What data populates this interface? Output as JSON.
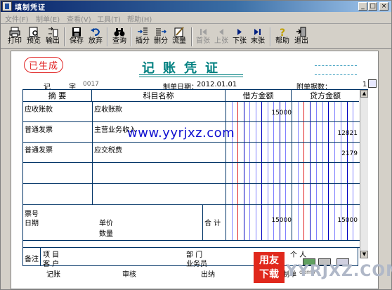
{
  "window": {
    "title": "填制凭证",
    "controls": [
      "_",
      "□",
      "×"
    ]
  },
  "menu": [
    "文件(F)",
    "制单(E)",
    "查看(V)",
    "工具(T)",
    "帮助(H)"
  ],
  "toolbar": [
    {
      "label": "打印",
      "icon": "printer-icon"
    },
    {
      "label": "预览",
      "icon": "preview-icon"
    },
    {
      "label": "输出",
      "icon": "export-icon"
    },
    {
      "label": "保存",
      "icon": "save-icon"
    },
    {
      "label": "放弃",
      "icon": "undo-icon"
    },
    {
      "label": "查询",
      "icon": "binoculars-icon"
    },
    {
      "label": "插分",
      "icon": "insert-row-icon"
    },
    {
      "label": "删分",
      "icon": "delete-row-icon"
    },
    {
      "label": "流量",
      "icon": "flow-icon"
    },
    {
      "label": "首张",
      "icon": "first-icon"
    },
    {
      "label": "上张",
      "icon": "prev-icon"
    },
    {
      "label": "下张",
      "icon": "next-icon"
    },
    {
      "label": "末张",
      "icon": "last-icon"
    },
    {
      "label": "帮助",
      "icon": "help-icon"
    },
    {
      "label": "退出",
      "icon": "exit-icon"
    }
  ],
  "voucher": {
    "stamp": "已生成",
    "title": "记账凭证",
    "type_prefix": "记",
    "type_label": "字",
    "number": "0017",
    "date_label": "制单日期：",
    "date": "2012.01.01",
    "attachments_label": "附单据数：",
    "attachments": "1",
    "columns": {
      "summary": "摘 要",
      "account": "科目名称",
      "debit": "借方金额",
      "credit": "贷方金额"
    },
    "rows": [
      {
        "summary": "应收账款",
        "account": "应收账款",
        "debit": "15000",
        "credit": ""
      },
      {
        "summary": "普通发票",
        "account": "主营业务收入",
        "debit": "",
        "credit": "12821"
      },
      {
        "summary": "普通发票",
        "account": "应交税费",
        "debit": "",
        "credit": "2179"
      },
      {
        "summary": "",
        "account": "",
        "debit": "",
        "credit": ""
      },
      {
        "summary": "",
        "account": "",
        "debit": "",
        "credit": ""
      }
    ],
    "totals": {
      "ticket_label": "票号",
      "date_label": "日期",
      "price_label": "单价",
      "qty_label": "数量",
      "total_label": "合 计",
      "debit_total": "15000",
      "credit_total": "15000"
    },
    "footer": {
      "note_label": "备注",
      "project_label": "项 目",
      "customer_label": "客 户",
      "dept_label": "部 门",
      "person_label": "个 人",
      "salesman_label": "业务员"
    },
    "signatures": {
      "bookkeeper": "记账",
      "reviewer": "审核",
      "cashier": "出纳",
      "maker": "制单",
      "maker_name": "demo"
    }
  },
  "watermark": {
    "url": "www.yyrjxz.com",
    "logo_top": "用友",
    "logo_bottom": "下载",
    "logo_url": "YYRJXZ.COM"
  }
}
